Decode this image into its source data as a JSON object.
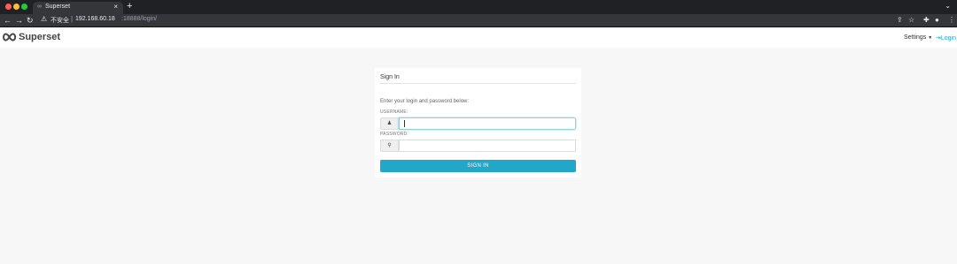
{
  "browser": {
    "tab_title": "Superset",
    "tab_close": "×",
    "new_tab": "+",
    "tab_menu": "⌄",
    "insecure_label": "不安全",
    "url_separator": "|",
    "url_host": "192.168.60.18",
    "url_path": ":18888/login/",
    "icons": [
      "back-icon",
      "forward-icon",
      "reload-icon",
      "warning-icon",
      "share-icon",
      "bookmark-star-icon",
      "extensions-icon",
      "profile-icon",
      "menu-icon"
    ]
  },
  "navbar": {
    "brand": "Superset",
    "settings_label": "Settings",
    "login_label": "Login"
  },
  "login": {
    "title": "Sign In",
    "prompt": "Enter your login and password below:",
    "username_label": "USERNAME:",
    "username_value": "",
    "password_label": "PASSWORD:",
    "password_value": "",
    "submit_label": "SIGN IN"
  },
  "colors": {
    "accent": "#20a7c9",
    "focus_border": "#8fd2d6",
    "page_background": "#f7f7f7"
  }
}
